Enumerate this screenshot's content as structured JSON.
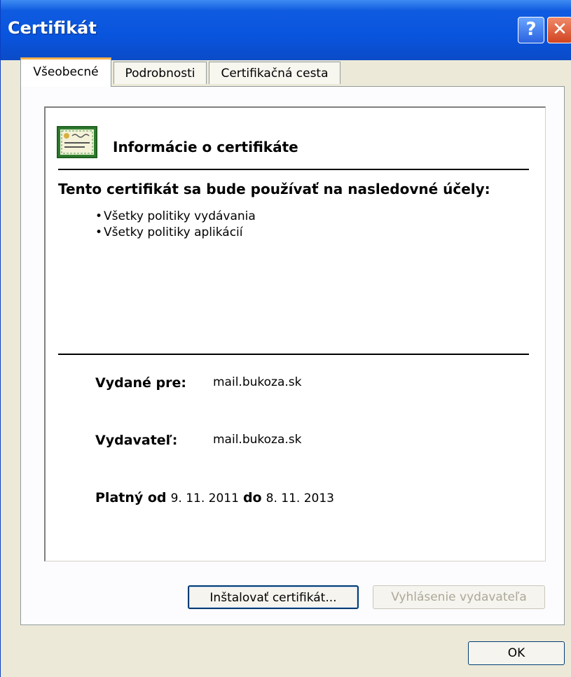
{
  "window": {
    "title": "Certifikát"
  },
  "tabs": [
    {
      "label": "Všeobecné",
      "active": true
    },
    {
      "label": "Podrobnosti",
      "active": false
    },
    {
      "label": "Certifikačná cesta",
      "active": false
    }
  ],
  "info": {
    "title": "Informácie o certifikáte",
    "purpose_heading": "Tento certifikát sa bude používať na nasledovné účely:",
    "purposes": [
      "Všetky politiky vydávania",
      "Všetky politiky aplikácií"
    ]
  },
  "fields": {
    "issued_to_label": "Vydané pre:",
    "issued_to_value": "mail.bukoza.sk",
    "issuer_label": "Vydavateľ:",
    "issuer_value": "mail.bukoza.sk",
    "valid_from_label": "Platný od",
    "valid_from_value": "9. 11. 2011",
    "valid_to_label": "do",
    "valid_to_value": "8. 11. 2013"
  },
  "buttons": {
    "install": "Inštalovať certifikát...",
    "issuer_statement": "Vyhlásenie vydavateľa",
    "ok": "OK"
  },
  "icons": {
    "help": "help-icon",
    "close": "close-icon",
    "certificate": "certificate-icon"
  }
}
